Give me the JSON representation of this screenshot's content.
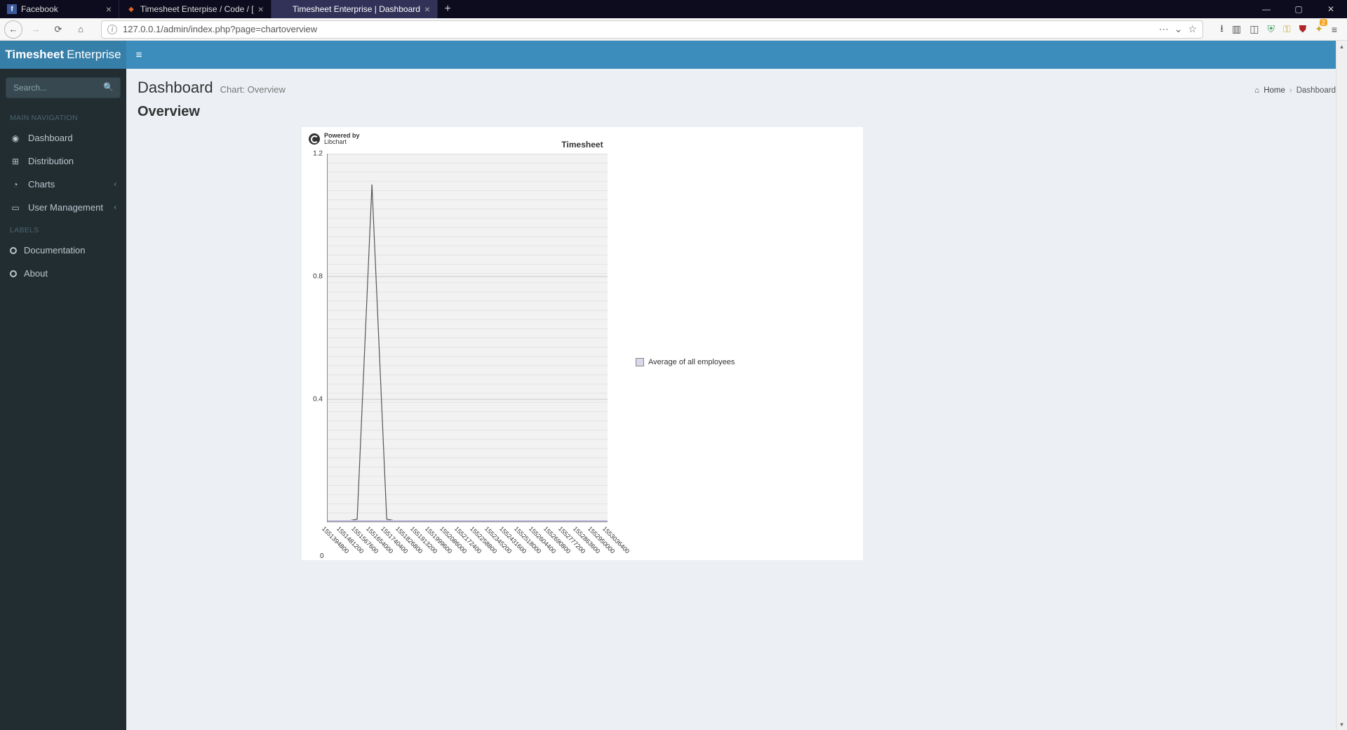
{
  "browser": {
    "tabs": [
      {
        "title": "Facebook",
        "favicon": "f",
        "favbg": "#3b5998",
        "active": false
      },
      {
        "title": "Timesheet Enterpise / Code / [",
        "favicon": "◆",
        "favbg": "#e2632a",
        "active": false
      },
      {
        "title": "Timesheet Enterprise | Dashboard",
        "favicon": "",
        "favbg": "transparent",
        "active": true
      }
    ],
    "url": "127.0.0.1/admin/index.php?page=chartoverview"
  },
  "brand": {
    "bold": "Timesheet",
    "light": "Enterprise"
  },
  "sidebar": {
    "search_placeholder": "Search...",
    "header1": "MAIN NAVIGATION",
    "items": [
      {
        "label": "Dashboard",
        "icon": "◉"
      },
      {
        "label": "Distribution",
        "icon": "⊞"
      },
      {
        "label": "Charts",
        "icon": "◔",
        "caret": true
      },
      {
        "label": "User Management",
        "icon": "▭",
        "caret": true
      }
    ],
    "header2": "LABELS",
    "labels": [
      {
        "label": "Documentation",
        "ring": "ring-red"
      },
      {
        "label": "About",
        "ring": "ring-yellow"
      }
    ]
  },
  "page": {
    "h1": "Dashboard",
    "subtitle": "Chart: Overview",
    "breadcrumb_home": "Home",
    "breadcrumb_current": "Dashboard",
    "section": "Overview"
  },
  "chart_data": {
    "type": "line",
    "title": "Timesheet",
    "powered_by_line1": "Powered by",
    "powered_by_line2": "Libchart",
    "legend": "Average of all employees",
    "ylim": [
      0,
      1.2
    ],
    "yticks": [
      0,
      0.4,
      0.8,
      1.2
    ],
    "x": [
      "1551394800",
      "1551481200",
      "1551567600",
      "1551654000",
      "1551740400",
      "1551826800",
      "1551913200",
      "1551999600",
      "1552086000",
      "1552172400",
      "1552258800",
      "1552345200",
      "1552431600",
      "1552518000",
      "1552604400",
      "1552690800",
      "1552777200",
      "1552863600",
      "1552950000",
      "1553036400"
    ],
    "series": [
      {
        "name": "Average of all employees",
        "values": [
          0,
          0,
          0.01,
          1.1,
          0.01,
          0,
          0,
          0,
          0,
          0,
          0,
          0,
          0,
          0,
          0,
          0,
          0,
          0,
          0,
          0
        ]
      }
    ]
  }
}
